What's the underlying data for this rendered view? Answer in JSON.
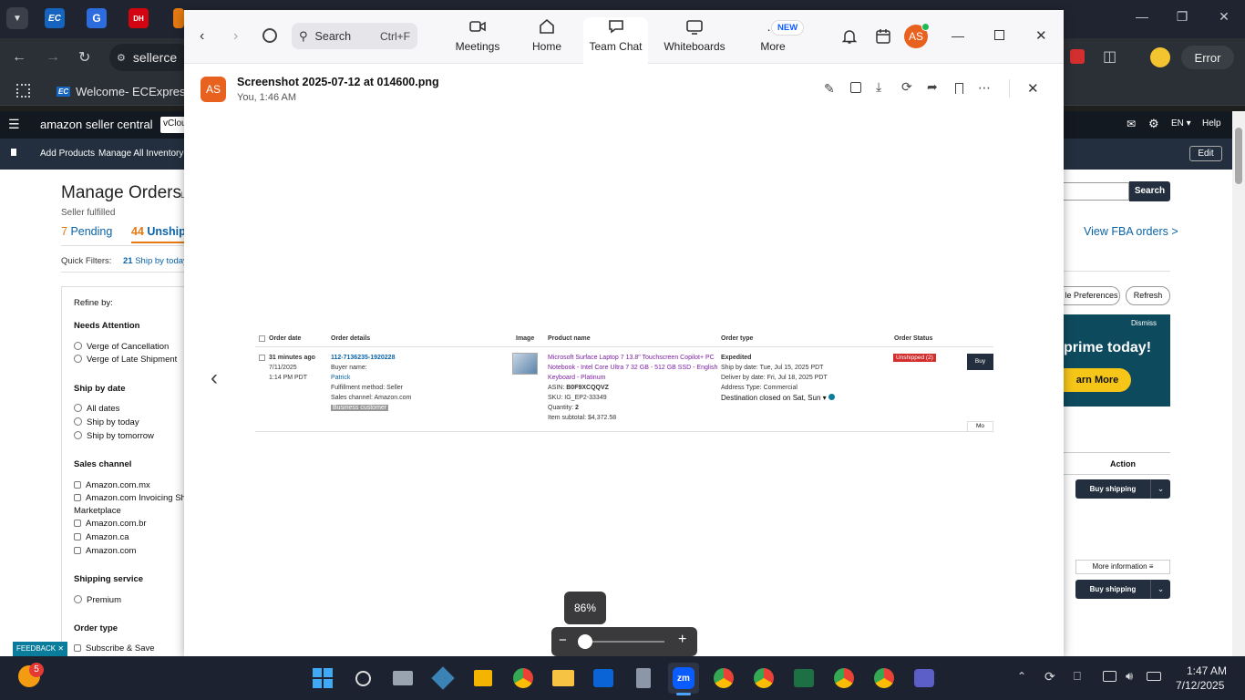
{
  "chrome": {
    "tab_label": "Welcome- ECExpres...",
    "address": "sellerce",
    "error_label": "Error",
    "bookmark_ec_label": "Welcome- ECExpres...",
    "tab_icon_ec": "EC",
    "tab_icon_dh": "DH"
  },
  "amazon": {
    "brand": "amazon seller central",
    "store_chip": "vClou",
    "lang": "EN",
    "help": "Help",
    "edit": "Edit",
    "nav_add_products": "Add Products",
    "nav_manage_inventory": "Manage All Inventory",
    "page_title": "Manage Orders",
    "page_title_suffix": "L",
    "seller_fulfilled": "Seller fulfilled",
    "pending_count": "7",
    "pending_label": "Pending",
    "unshipped_count": "44",
    "unshipped_label": "Unshipp",
    "quick_filters": "Quick Filters:",
    "ship_today_count": "21",
    "ship_today_label": "Ship by today",
    "search_button": "Search",
    "view_fba": "View FBA orders >",
    "prefs_button": "le Preferences",
    "refresh_button": "Refresh",
    "banner_dismiss": "Dismiss",
    "banner_title": "prime today!",
    "banner_cta": "arn More",
    "action_header": "Action",
    "buy_shipping_1": "Buy shipping",
    "more_info": "More information",
    "buy_shipping_2": "Buy shipping",
    "refine_by": "Refine by:",
    "needs_attention": "Needs Attention",
    "verge_cancel": "Verge of Cancellation",
    "verge_late": "Verge of Late Shipment",
    "ship_by_date": "Ship by date",
    "all_dates": "All dates",
    "ship_today": "Ship by today",
    "ship_tomorrow": "Ship by tomorrow",
    "sales_channel": "Sales channel",
    "ch_mx": "Amazon.com.mx",
    "ch_invoicing": "Amazon.com Invoicing Sh",
    "ch_marketplace": "Marketplace",
    "ch_br": "Amazon.com.br",
    "ch_ca": "Amazon.ca",
    "ch_com": "Amazon.com",
    "shipping_service": "Shipping service",
    "premium": "Premium",
    "order_type": "Order type",
    "subscribe_save": "Subscribe & Save",
    "feedback": "FEEDBACK"
  },
  "zoom": {
    "search_label": "Search",
    "search_shortcut": "Ctrl+F",
    "nav": [
      {
        "label": "Meetings",
        "icon": "video-camera-icon"
      },
      {
        "label": "Home",
        "icon": "home-icon"
      },
      {
        "label": "Team Chat",
        "icon": "chat-icon"
      },
      {
        "label": "Whiteboards",
        "icon": "whiteboard-icon"
      },
      {
        "label": "More",
        "icon": "more-icon"
      }
    ],
    "new_badge": "NEW",
    "avatar_initials": "AS",
    "file_title": "Screenshot 2025-07-12 at 014600.png",
    "file_meta": "You, 1:46 AM",
    "zoom_level": "86%"
  },
  "shot": {
    "headers": [
      "Order date",
      "Order details",
      "Image",
      "Product name",
      "Order type",
      "Order Status"
    ],
    "order_age": "31 minutes ago",
    "order_date": "7/11/2025",
    "order_time": "1:14 PM PDT",
    "order_id": "112-7136235-1920228",
    "buyer_name_label": "Buyer name:",
    "buyer_name": "Patrick",
    "fulfillment": "Fulfillment method: Seller",
    "sales_channel": "Sales channel: Amazon.com",
    "business_badge": "Business customer",
    "product_line1": "Microsoft Surface Laptop 7 13.8\" Touchscreen Copilot+ PC",
    "product_line2": "Notebook - Intel Core Ultra 7 32 GB - 512 GB SSD - English",
    "product_line3": "Keyboard - Platinum",
    "asin_label": "ASIN:",
    "asin": "B0F9XCQQVZ",
    "sku_label": "SKU:",
    "sku": "IG_EP2-33349",
    "qty_label": "Quantity:",
    "qty": "2",
    "subtotal_label": "Item subtotal:",
    "subtotal": "$4,372.58",
    "order_type": "Expedited",
    "ship_by": "Ship by date: Tue, Jul 15, 2025 PDT",
    "deliver_by": "Deliver by date: Fri, Jul 18, 2025 PDT",
    "address_type": "Address Type: Commercial",
    "destination": "Destination closed on Sat, Sun",
    "status_badge": "Unshipped (2)",
    "buy_btn": "Buy",
    "more_btn": "Mo"
  },
  "taskbar": {
    "weather_badge": "5",
    "time": "1:47 AM",
    "date": "7/12/2025"
  }
}
